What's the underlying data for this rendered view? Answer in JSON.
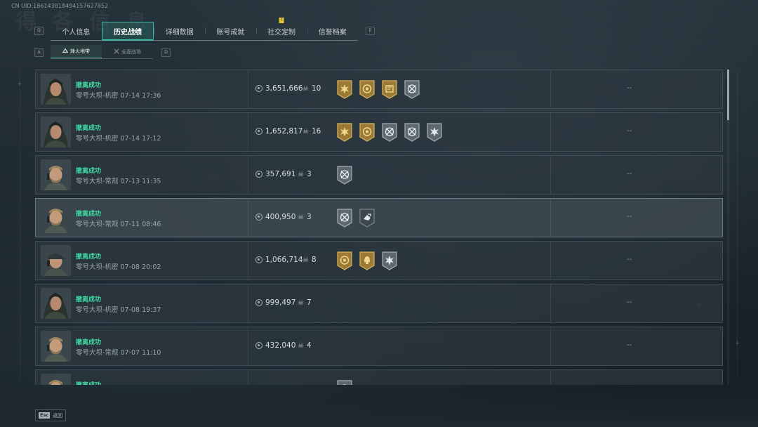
{
  "uid": "CN UID:18614381849415762785​2",
  "uid_text": "CN UID:186143818494157627852",
  "bg_title": "得 各 信 息",
  "tabs": [
    {
      "label": "个人信息",
      "active": false,
      "badge": ""
    },
    {
      "label": "历史战绩",
      "active": true,
      "badge": ""
    },
    {
      "label": "详细数据",
      "active": false,
      "badge": ""
    },
    {
      "label": "账号成就",
      "active": false,
      "badge": ""
    },
    {
      "label": "社交定制",
      "active": false,
      "badge": "!"
    },
    {
      "label": "信誉档案",
      "active": false,
      "badge": ""
    }
  ],
  "tab_keys": {
    "prev": "Q",
    "next": "E"
  },
  "subtabs": [
    {
      "label": "烽火地带",
      "active": true,
      "icon": "extraction-icon"
    },
    {
      "label": "全面战场",
      "active": false,
      "icon": "battlefield-icon"
    }
  ],
  "subtab_keys": {
    "prev": "A",
    "next": "D"
  },
  "matches": [
    {
      "status": "撤离成功",
      "detail": "零号大坝-机密 07-14 17:36",
      "value": "3,651,666",
      "kills": "10",
      "result": "--",
      "avatar": "female-operator",
      "medals": [
        "gold-burst-medal",
        "gold-target-medal",
        "gold-map-medal",
        "silver-crossed-medal"
      ],
      "highlight": false
    },
    {
      "status": "撤离成功",
      "detail": "零号大坝-机密 07-14 17:12",
      "value": "1,652,817",
      "kills": "16",
      "result": "--",
      "avatar": "female-operator",
      "medals": [
        "gold-burst-medal",
        "gold-target-medal",
        "silver-crossed-medal",
        "silver-crossed-medal",
        "silver-star-medal"
      ],
      "highlight": false
    },
    {
      "status": "撤离成功",
      "detail": "零号大坝-常规 07-13 11:35",
      "value": "357,691",
      "kills": "3",
      "result": "--",
      "avatar": "male-operator",
      "medals": [
        "silver-crossed-medal"
      ],
      "highlight": false
    },
    {
      "status": "撤离成功",
      "detail": "零号大坝-常规 07-11 08:46",
      "value": "400,950",
      "kills": "3",
      "result": "--",
      "avatar": "male-operator",
      "medals": [
        "silver-crossed-medal",
        "dark-loot-medal"
      ],
      "highlight": true
    },
    {
      "status": "撤离成功",
      "detail": "零号大坝-机密 07-08 20:02",
      "value": "1,066,714",
      "kills": "8",
      "result": "--",
      "avatar": "cap-operator",
      "medals": [
        "gold-target-medal",
        "gold-helmet-medal",
        "silver-star-medal"
      ],
      "highlight": false
    },
    {
      "status": "撤离成功",
      "detail": "零号大坝-机密 07-08 19:37",
      "value": "999,497",
      "kills": "7",
      "result": "--",
      "avatar": "female-operator",
      "medals": [],
      "highlight": false
    },
    {
      "status": "撤离成功",
      "detail": "零号大坝-常规 07-07 11:10",
      "value": "432,040",
      "kills": "4",
      "result": "--",
      "avatar": "male-operator",
      "medals": [],
      "highlight": false
    },
    {
      "status": "撤离成功",
      "detail": "",
      "value": "",
      "kills": "",
      "result": "",
      "avatar": "male-operator",
      "medals": [
        "silver-crossed-medal"
      ],
      "highlight": false
    }
  ],
  "footer": {
    "key": "Esc",
    "label": "返回"
  },
  "colors": {
    "accent": "#3fb9a4",
    "success": "#3fd9a4",
    "gold_medal": "#b08a3e",
    "silver_medal": "#6c767c",
    "badge": "#e4c23a"
  }
}
